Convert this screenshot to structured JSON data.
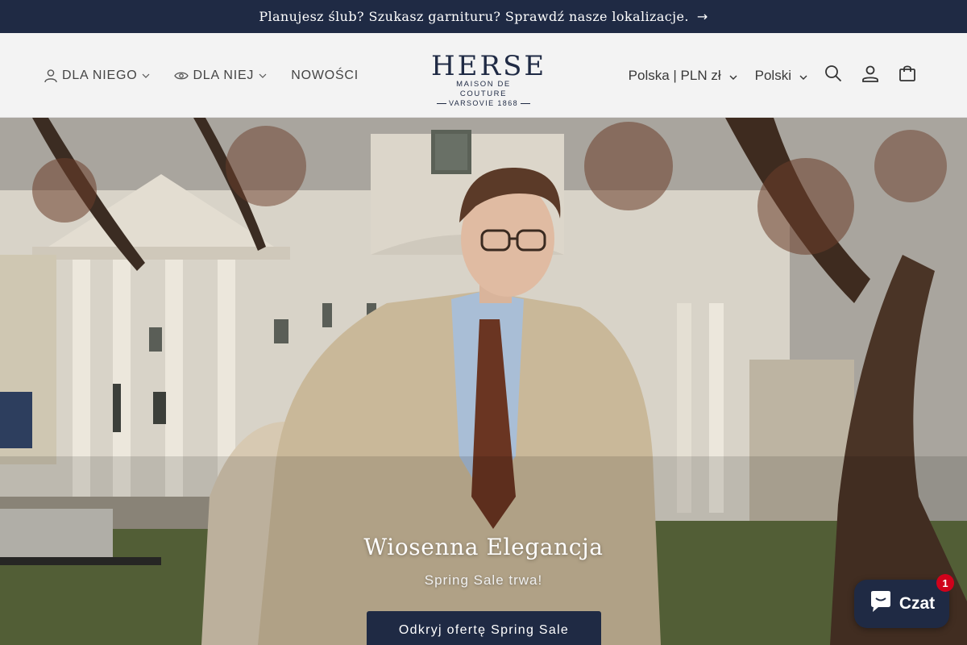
{
  "announcement": {
    "text": "Planujesz ślub? Szukasz garnituru? Sprawdź nasze lokalizacje.",
    "arrow": "→"
  },
  "nav": {
    "left": [
      {
        "label": "DLA NIEGO",
        "icon": "person-icon",
        "has_dropdown": true
      },
      {
        "label": "DLA NIEJ",
        "icon": "eye-icon",
        "has_dropdown": true
      },
      {
        "label": "NOWOŚCI",
        "icon": null,
        "has_dropdown": false
      }
    ],
    "country_selector": "Polska | PLN zł",
    "language_selector": "Polski"
  },
  "logo": {
    "brand": "HERSE",
    "line1": "MAISON DE COUTURE",
    "line2": "VARSOVIE 1868"
  },
  "hero": {
    "title": "Wiosenna Elegancja",
    "subtitle": "Spring Sale trwa!",
    "cta": "Odkryj ofertę Spring Sale"
  },
  "chat": {
    "label": "Czat",
    "badge": "1"
  },
  "colors": {
    "navy": "#1f2a44",
    "header_bg": "#f3f3f3",
    "badge_red": "#d0021b"
  }
}
